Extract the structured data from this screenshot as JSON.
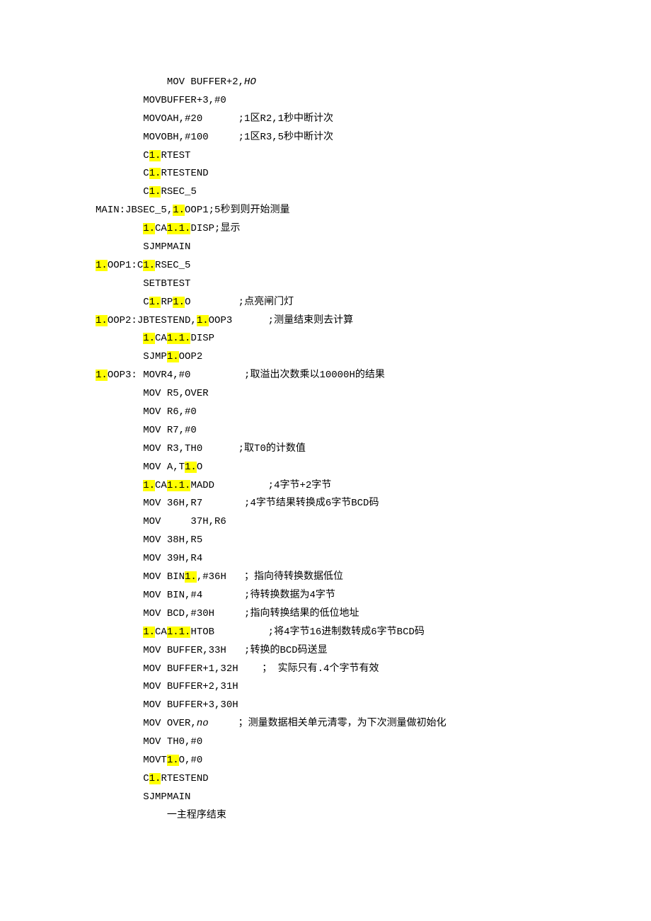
{
  "lines": [
    {
      "indent": 3,
      "segments": [
        {
          "t": "MOV BUFFER+2,"
        },
        {
          "t": "HO",
          "it": true
        }
      ]
    },
    {
      "indent": 2,
      "segments": [
        {
          "t": "MOVBUFFER+3,#0"
        }
      ]
    },
    {
      "indent": 2,
      "segments": [
        {
          "t": "MOVOAH,#20      ;1区R2,1秒中断计次"
        }
      ]
    },
    {
      "indent": 2,
      "segments": [
        {
          "t": "MOVOBH,#100     ;1区R3,5秒中断计次"
        }
      ]
    },
    {
      "indent": 2,
      "segments": [
        {
          "t": "C"
        },
        {
          "t": "1.",
          "hl": true
        },
        {
          "t": "RTEST"
        }
      ]
    },
    {
      "indent": 2,
      "segments": [
        {
          "t": "C"
        },
        {
          "t": "1.",
          "hl": true
        },
        {
          "t": "RTESTEND"
        }
      ]
    },
    {
      "indent": 2,
      "segments": [
        {
          "t": "C"
        },
        {
          "t": "1.",
          "hl": true
        },
        {
          "t": "RSEC_5"
        }
      ]
    },
    {
      "indent": 0,
      "segments": [
        {
          "t": "MAIN:JBSEC_5,"
        },
        {
          "t": "1.",
          "hl": true
        },
        {
          "t": "OOP1;5秒到则开始测量"
        }
      ]
    },
    {
      "indent": 2,
      "segments": [
        {
          "t": "1.",
          "hl": true
        },
        {
          "t": "CA"
        },
        {
          "t": "1.1.",
          "hl": true
        },
        {
          "t": "DISP;显示"
        }
      ]
    },
    {
      "indent": 2,
      "segments": [
        {
          "t": "SJMPMAIN"
        }
      ]
    },
    {
      "indent": 0,
      "segments": [
        {
          "t": "1.",
          "hl": true
        },
        {
          "t": "OOP1:C"
        },
        {
          "t": "1.",
          "hl": true
        },
        {
          "t": "RSEC_5"
        }
      ]
    },
    {
      "indent": 2,
      "segments": [
        {
          "t": "SETBTEST"
        }
      ]
    },
    {
      "indent": 2,
      "segments": [
        {
          "t": "C"
        },
        {
          "t": "1.",
          "hl": true
        },
        {
          "t": "RP"
        },
        {
          "t": "1.",
          "hl": true
        },
        {
          "t": "O        ;点亮闸门灯"
        }
      ]
    },
    {
      "indent": 0,
      "segments": [
        {
          "t": "1.",
          "hl": true
        },
        {
          "t": "OOP2:JBTESTEND,"
        },
        {
          "t": "1.",
          "hl": true
        },
        {
          "t": "OOP3      ;测量结束则去计算"
        }
      ]
    },
    {
      "indent": 2,
      "segments": [
        {
          "t": "1.",
          "hl": true
        },
        {
          "t": "CA"
        },
        {
          "t": "1.1.",
          "hl": true
        },
        {
          "t": "DISP"
        }
      ]
    },
    {
      "indent": 2,
      "segments": [
        {
          "t": "SJMP"
        },
        {
          "t": "1.",
          "hl": true
        },
        {
          "t": "OOP2"
        }
      ]
    },
    {
      "indent": 0,
      "segments": [
        {
          "t": "1.",
          "hl": true
        },
        {
          "t": "OOP3: MOVR4,#0         ;取溢出次数乘以10000H的结果"
        }
      ]
    },
    {
      "indent": 2,
      "segments": [
        {
          "t": "MOV R5,OVER"
        }
      ]
    },
    {
      "indent": 2,
      "segments": [
        {
          "t": "MOV R6,#0"
        }
      ]
    },
    {
      "indent": 2,
      "segments": [
        {
          "t": "MOV R7,#0"
        }
      ]
    },
    {
      "indent": 2,
      "segments": [
        {
          "t": "MOV R3,TH0      ;取T0的计数值"
        }
      ]
    },
    {
      "indent": 2,
      "segments": [
        {
          "t": "MOV A,T"
        },
        {
          "t": "1.",
          "hl": true
        },
        {
          "t": "O"
        }
      ]
    },
    {
      "indent": 2,
      "segments": [
        {
          "t": "1.",
          "hl": true
        },
        {
          "t": "CA"
        },
        {
          "t": "1.1.",
          "hl": true
        },
        {
          "t": "MADD         ;4字节+2字节"
        }
      ]
    },
    {
      "indent": 2,
      "segments": [
        {
          "t": "MOV 36H,R7       ;4字节结果转换成6字节BCD码"
        }
      ]
    },
    {
      "indent": 2,
      "segments": [
        {
          "t": "MOV     37H,R6"
        }
      ]
    },
    {
      "indent": 2,
      "segments": [
        {
          "t": "MOV 38H,R5"
        }
      ]
    },
    {
      "indent": 2,
      "segments": [
        {
          "t": "MOV 39H,R4"
        }
      ]
    },
    {
      "indent": 2,
      "segments": [
        {
          "t": "MOV BIN"
        },
        {
          "t": "1.",
          "hl": true
        },
        {
          "t": ",#36H   ；指向待转换数据低位"
        }
      ]
    },
    {
      "indent": 2,
      "segments": [
        {
          "t": "MOV BIN,#4       ;待转换数据为4字节"
        }
      ]
    },
    {
      "indent": 2,
      "segments": [
        {
          "t": "MOV BCD,#30H     ;指向转换结果的低位地址"
        }
      ]
    },
    {
      "indent": 2,
      "segments": [
        {
          "t": "1.",
          "hl": true
        },
        {
          "t": "CA"
        },
        {
          "t": "1.1.",
          "hl": true
        },
        {
          "t": "HTOB         ;将4字节16进制数转成6字节BCD码"
        }
      ]
    },
    {
      "indent": 2,
      "segments": [
        {
          "t": "MOV BUFFER,33H   ;转换的BCD码送显"
        }
      ]
    },
    {
      "indent": 2,
      "segments": [
        {
          "t": "MOV BUFFER+1,32H    ； 实际只有.4个字节有效"
        }
      ]
    },
    {
      "indent": 2,
      "segments": [
        {
          "t": "MOV BUFFER+2,31H"
        }
      ]
    },
    {
      "indent": 2,
      "segments": [
        {
          "t": "MOV BUFFER+3,30H"
        }
      ]
    },
    {
      "indent": 2,
      "segments": [
        {
          "t": "MOV OVER,"
        },
        {
          "t": "no",
          "it": true
        },
        {
          "t": "     ；测量数据相关单元清零，为下次测量做初始化"
        }
      ]
    },
    {
      "indent": 2,
      "segments": [
        {
          "t": "MOV TH0,#0"
        }
      ]
    },
    {
      "indent": 2,
      "segments": [
        {
          "t": "MOVT"
        },
        {
          "t": "1.",
          "hl": true
        },
        {
          "t": "O,#0"
        }
      ]
    },
    {
      "indent": 2,
      "segments": [
        {
          "t": "C"
        },
        {
          "t": "1.",
          "hl": true
        },
        {
          "t": "RTESTEND"
        }
      ]
    },
    {
      "indent": 2,
      "segments": [
        {
          "t": "SJMPMAIN"
        }
      ]
    },
    {
      "indent": 3,
      "segments": [
        {
          "t": "一主程序结束"
        }
      ]
    }
  ],
  "indentUnit": "    "
}
